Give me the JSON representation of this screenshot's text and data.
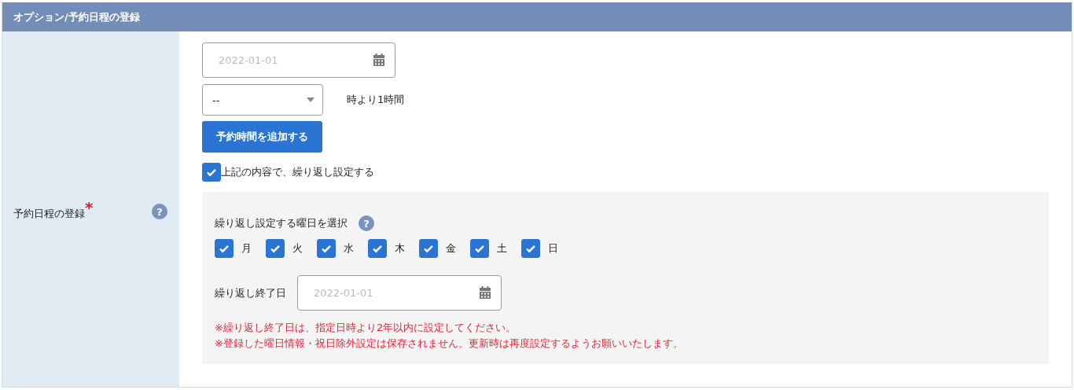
{
  "panel": {
    "title": "オプション/予約日程の登録"
  },
  "field": {
    "label": "予約日程の登録",
    "required_mark": "*",
    "help": "?"
  },
  "date_input": {
    "placeholder": "2022-01-01"
  },
  "hour_select": {
    "value": "--"
  },
  "hour_suffix": "時より1時間",
  "add_button": "予約時間を追加する",
  "repeat": {
    "label": "上記の内容で、繰り返し設定する",
    "checked": true
  },
  "repeat_box": {
    "weekday_title": "繰り返し設定する曜日を選択",
    "help": "?",
    "weekdays": [
      {
        "label": "月",
        "checked": true
      },
      {
        "label": "火",
        "checked": true
      },
      {
        "label": "水",
        "checked": true
      },
      {
        "label": "木",
        "checked": true
      },
      {
        "label": "金",
        "checked": true
      },
      {
        "label": "土",
        "checked": true
      },
      {
        "label": "日",
        "checked": true
      }
    ],
    "end_date_label": "繰り返し終了日",
    "end_date_placeholder": "2022-01-01",
    "notes": [
      "※繰り返し終了日は、指定日時より2年以内に設定してください。",
      "※登録した曜日情報・祝日除外設定は保存されません。更新時は再度設定するようお願いいたします。"
    ]
  }
}
